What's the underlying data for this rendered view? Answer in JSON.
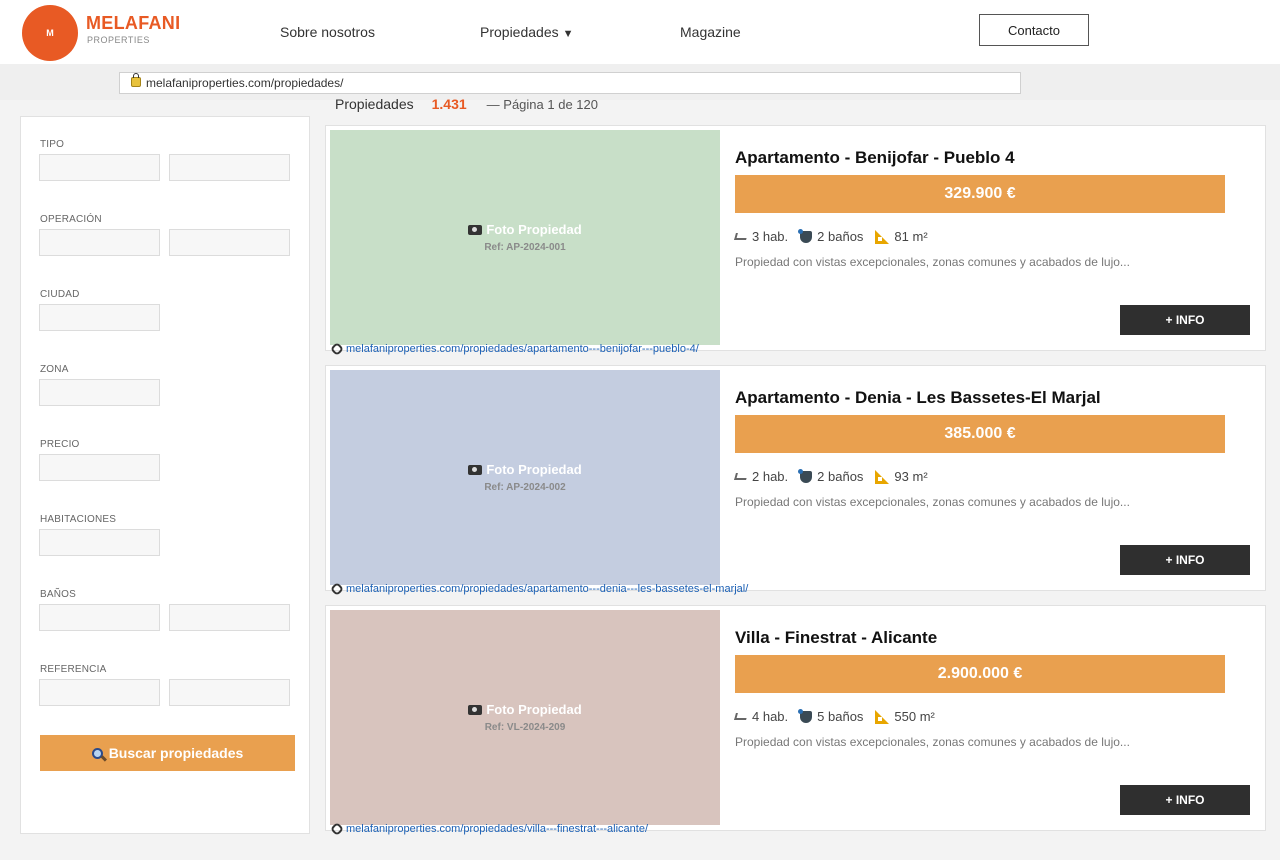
{
  "header": {
    "logo_text": "M",
    "brand": "MELAFANI",
    "brand_sub": "PROPERTIES",
    "nav": [
      "Sobre nosotros",
      "Propiedades",
      "Magazine"
    ],
    "nav_caret": "▼",
    "contact_label": "Contacto"
  },
  "address_bar": {
    "url": "melafaniproperties.com/propiedades/"
  },
  "results": {
    "label": "Propiedades",
    "count": "1.431",
    "page_info": "— Página 1 de 120"
  },
  "filters": {
    "labels": [
      "TIPO",
      "OPERACIÓN",
      "CIUDAD",
      "ZONA",
      "PRECIO",
      "HABITACIONES",
      "BAÑOS",
      "REFERENCIA"
    ],
    "search_label": "Buscar propiedades"
  },
  "listings": [
    {
      "title": "Apartamento - Benijofar - Pueblo 4",
      "price": "329.900 €",
      "photo_label": "Foto Propiedad",
      "ref": "Ref: AP-2024-001",
      "photo_color": "#c8dfc8",
      "beds": "3 hab.",
      "baths": "2 baños",
      "area": "81 m²",
      "description": "Propiedad con vistas excepcionales, zonas comunes y acabados de lujo...",
      "info_label": "+ INFO",
      "link": "melafaniproperties.com/propiedades/apartamento---benijofar---pueblo-4/"
    },
    {
      "title": "Apartamento - Denia - Les Bassetes-El Marjal",
      "price": "385.000 €",
      "photo_label": "Foto Propiedad",
      "ref": "Ref: AP-2024-002",
      "photo_color": "#c4cde0",
      "beds": "2 hab.",
      "baths": "2 baños",
      "area": "93 m²",
      "description": "Propiedad con vistas excepcionales, zonas comunes y acabados de lujo...",
      "info_label": "+ INFO",
      "link": "melafaniproperties.com/propiedades/apartamento---denia---les-bassetes-el-marjal/"
    },
    {
      "title": "Villa - Finestrat - Alicante",
      "price": "2.900.000 €",
      "photo_label": "Foto Propiedad",
      "ref": "Ref: VL-2024-209",
      "photo_color": "#d8c4be",
      "beds": "4 hab.",
      "baths": "5 baños",
      "area": "550 m²",
      "description": "Propiedad con vistas excepcionales, zonas comunes y acabados de lujo...",
      "info_label": "+ INFO",
      "link": "melafaniproperties.com/propiedades/villa---finestrat---alicante/"
    }
  ],
  "colors": {
    "brand": "#e85a24",
    "price_bar": "#e9a04f",
    "info_button": "#2f2f2f",
    "link": "#1a5fb4"
  }
}
